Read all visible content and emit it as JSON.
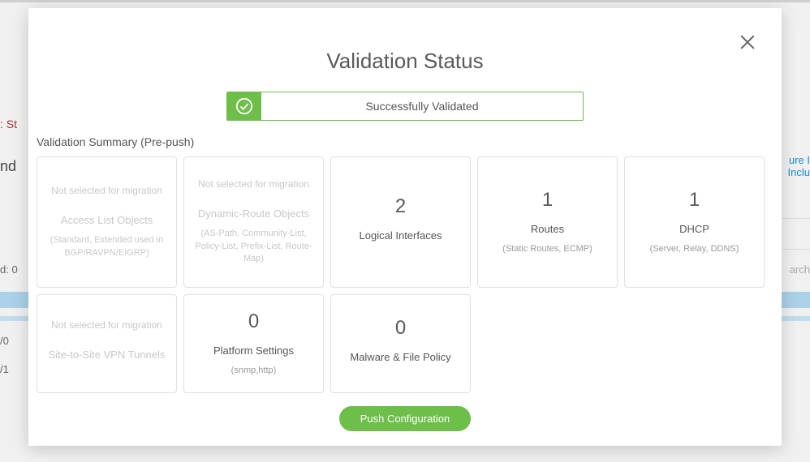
{
  "background": {
    "top_text": ": St",
    "nd": "nd",
    "d0": "d: 0",
    "slash0": "/0",
    "slash1": "/1",
    "right1": "ure I\nInclu",
    "search": "arch"
  },
  "modal": {
    "title": "Validation Status",
    "status_text": "Successfully Validated",
    "summary_label": "Validation Summary (Pre-push)",
    "not_selected_label": "Not selected for migration",
    "cards_row1": [
      {
        "disabled": true,
        "title": "Access List Objects",
        "sub": "(Standard, Extended used in BGP/RAVPN/EIGRP)"
      },
      {
        "disabled": true,
        "title": "Dynamic-Route Objects",
        "sub": "(AS-Path, Community-List, Policy-List, Prefix-List, Route-Map)"
      },
      {
        "count": "2",
        "title": "Logical Interfaces",
        "sub": ""
      },
      {
        "count": "1",
        "title": "Routes",
        "sub": "(Static Routes, ECMP)"
      },
      {
        "count": "1",
        "title": "DHCP",
        "sub": "(Server, Relay, DDNS)"
      }
    ],
    "cards_row2": [
      {
        "disabled": true,
        "title": "Site-to-Site VPN Tunnels",
        "sub": ""
      },
      {
        "count": "0",
        "title": "Platform Settings",
        "sub": "(snmp,http)"
      },
      {
        "count": "0",
        "title": "Malware & File Policy",
        "sub": ""
      }
    ],
    "push_button": "Push Configuration"
  }
}
